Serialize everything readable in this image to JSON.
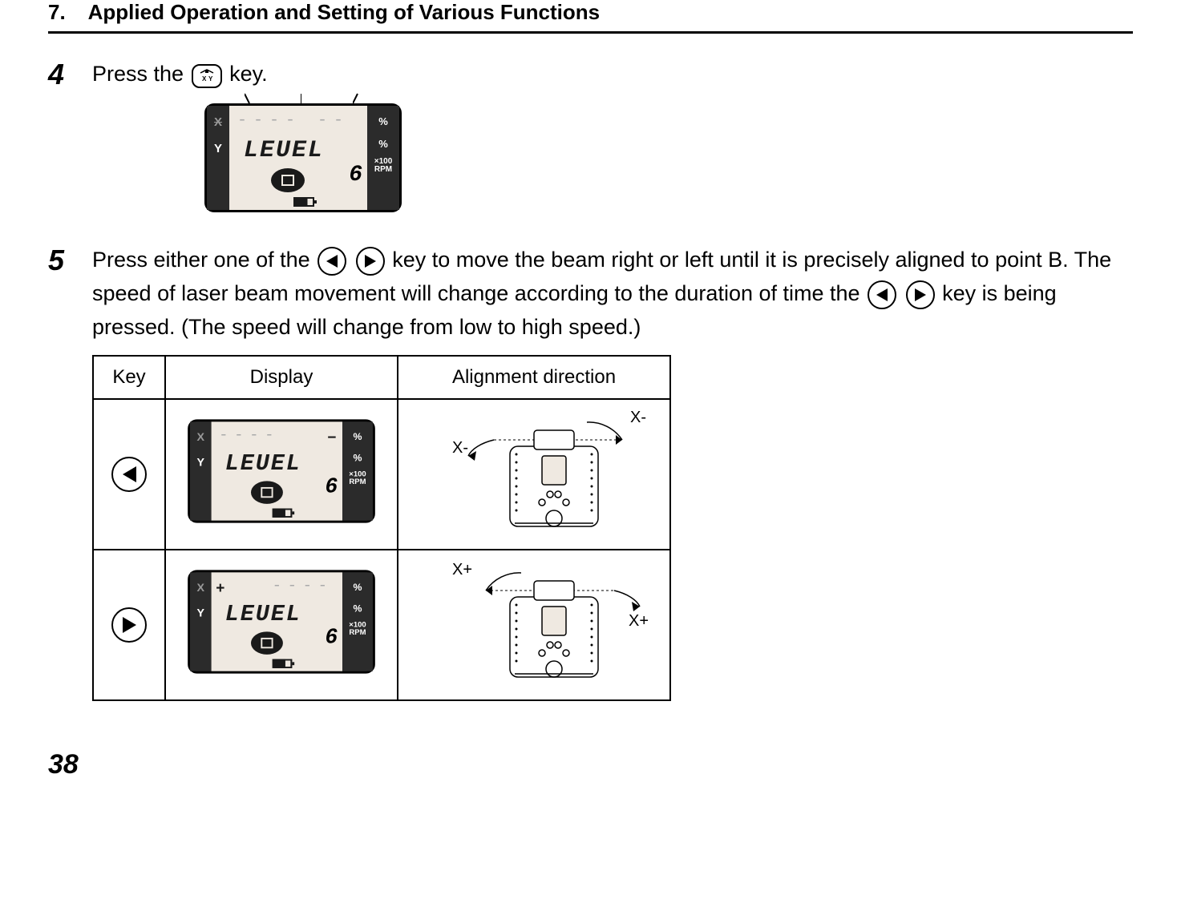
{
  "page": {
    "section_number": "7.",
    "section_title": "Applied Operation and Setting of Various Functions",
    "page_number": "38"
  },
  "step4": {
    "number": "4",
    "text_before": "Press the ",
    "text_after": " key."
  },
  "step5": {
    "number": "5",
    "text_a": "Press either one of the ",
    "text_b": " key to move the beam right or left until it is precisely aligned to point B. The speed of laser beam movement will change according to the duration of time the ",
    "text_c": " key is being pressed. (The speed will change from low to high speed.)"
  },
  "lcd": {
    "x_label": "X",
    "y_label": "Y",
    "level_text": "LEUEL",
    "six": "6",
    "percent": "%",
    "x100": "×100",
    "rpm": "RPM"
  },
  "table": {
    "headers": {
      "key": "Key",
      "display": "Display",
      "alignment": "Alignment direction"
    },
    "row1": {
      "labels": {
        "xminus_top": "X-",
        "xminus_side": "X-"
      }
    },
    "row2": {
      "labels": {
        "xplus_top": "X+",
        "xplus_side": "X+"
      }
    }
  }
}
